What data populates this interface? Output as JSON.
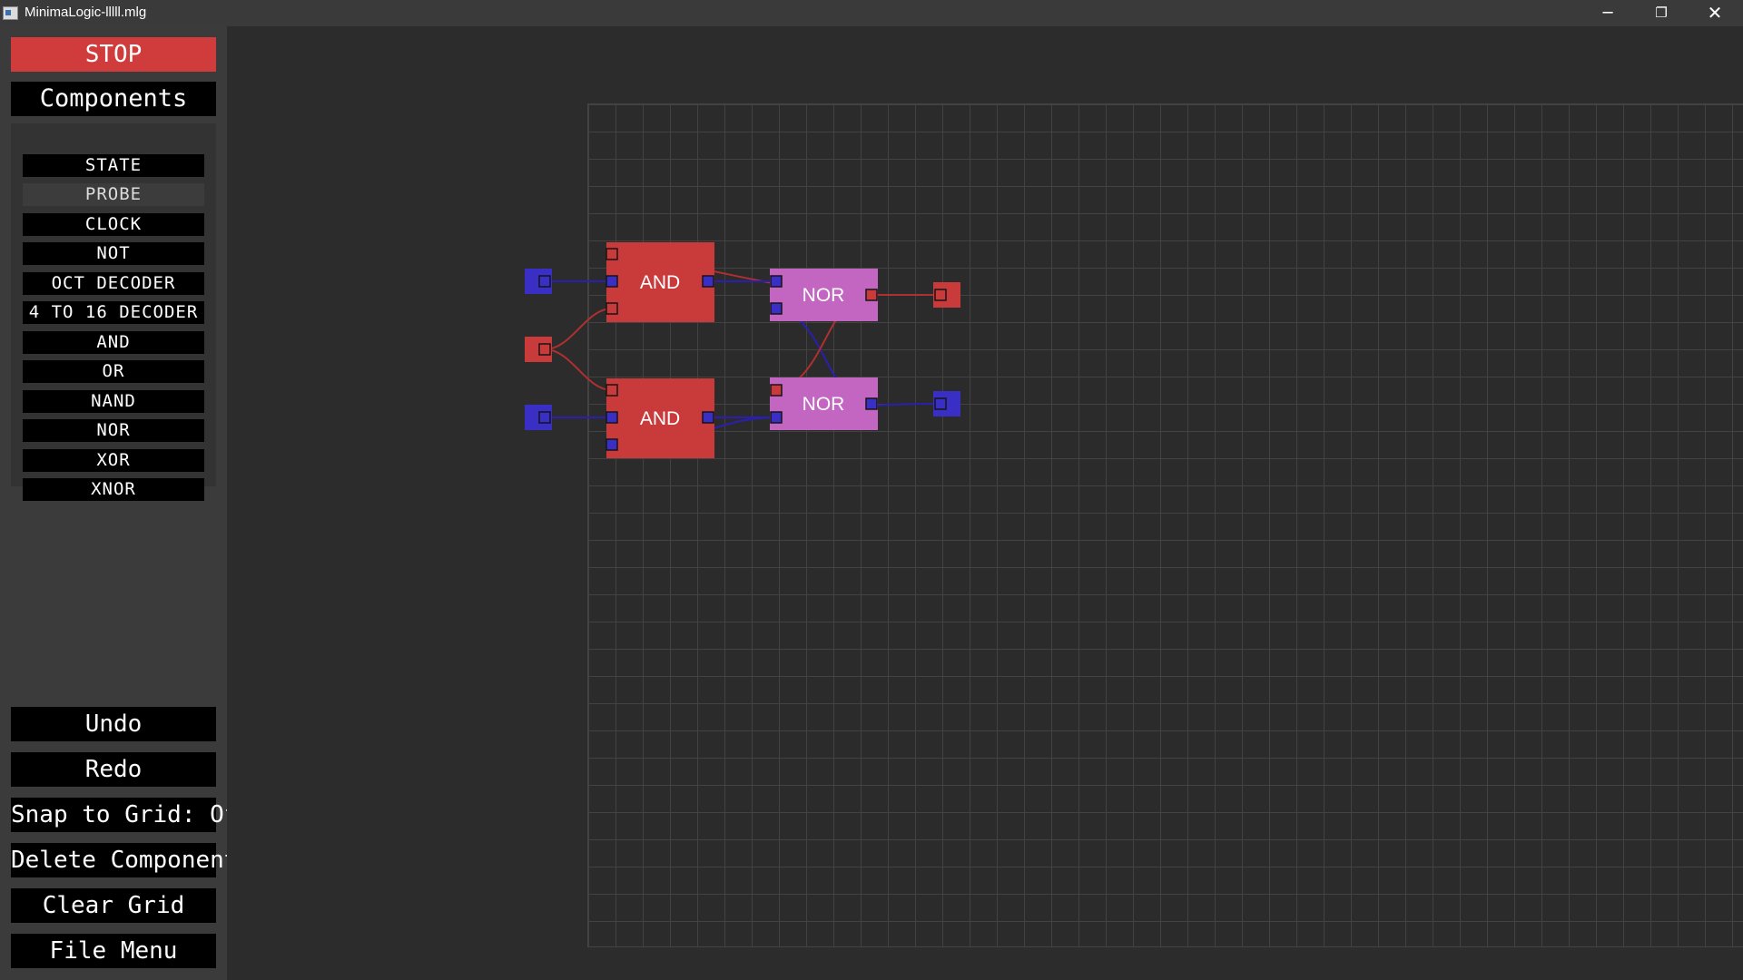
{
  "window": {
    "title": "MinimaLogic-lllll.mlg",
    "minimize_glyph": "─",
    "restore_glyph": "❐",
    "close_glyph": "✕"
  },
  "sidebar": {
    "stop_label": "STOP",
    "components_label": "Components",
    "components": [
      {
        "label": "STATE"
      },
      {
        "label": "PROBE"
      },
      {
        "label": "CLOCK"
      },
      {
        "label": "NOT"
      },
      {
        "label": "OCT DECODER"
      },
      {
        "label": "4 TO 16 DECODER"
      },
      {
        "label": "AND"
      },
      {
        "label": "OR"
      },
      {
        "label": "NAND"
      },
      {
        "label": "NOR"
      },
      {
        "label": "XOR"
      },
      {
        "label": "XNOR"
      }
    ],
    "actions": [
      {
        "label": "Undo"
      },
      {
        "label": "Redo"
      },
      {
        "label": "Snap to Grid: Off"
      },
      {
        "label": "Delete Component"
      },
      {
        "label": "Clear Grid"
      },
      {
        "label": "File Menu"
      }
    ]
  },
  "circuit": {
    "gates": [
      {
        "label": "AND"
      },
      {
        "label": "AND"
      },
      {
        "label": "NOR"
      },
      {
        "label": "NOR"
      }
    ],
    "colors": {
      "high": "#c93b3b",
      "low": "#3a2fc4",
      "nor_fill": "#c266c2",
      "wire_high": "#b03030",
      "wire_low": "#2a1fb0"
    }
  }
}
